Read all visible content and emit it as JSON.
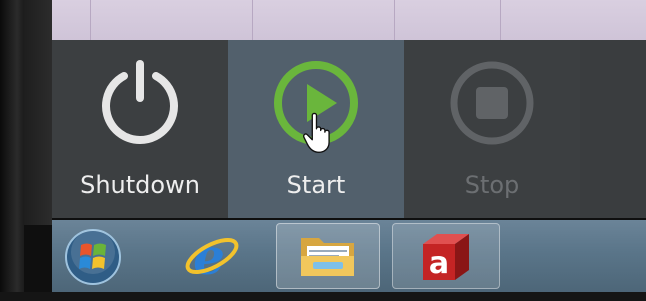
{
  "actions": {
    "shutdown": {
      "label": "Shutdown",
      "icon": "power-icon"
    },
    "start": {
      "label": "Start",
      "icon": "play-icon"
    },
    "stop": {
      "label": "Stop",
      "icon": "stop-icon"
    }
  },
  "taskbar": {
    "items": [
      {
        "name": "windows-start-orb",
        "icon": "windows-logo-icon"
      },
      {
        "name": "internet-explorer",
        "icon": "internet-explorer-icon"
      },
      {
        "name": "windows-explorer",
        "icon": "folder-icon"
      },
      {
        "name": "application",
        "icon": "red-cube-a-icon"
      }
    ]
  },
  "colors": {
    "start_accent": "#6ab63c",
    "icon_white": "#e6e6e6",
    "disabled": "#606366",
    "start_tile_bg": "#52606c",
    "tile_bg": "#3c3f41"
  },
  "cursor": "hand-pointer-icon"
}
